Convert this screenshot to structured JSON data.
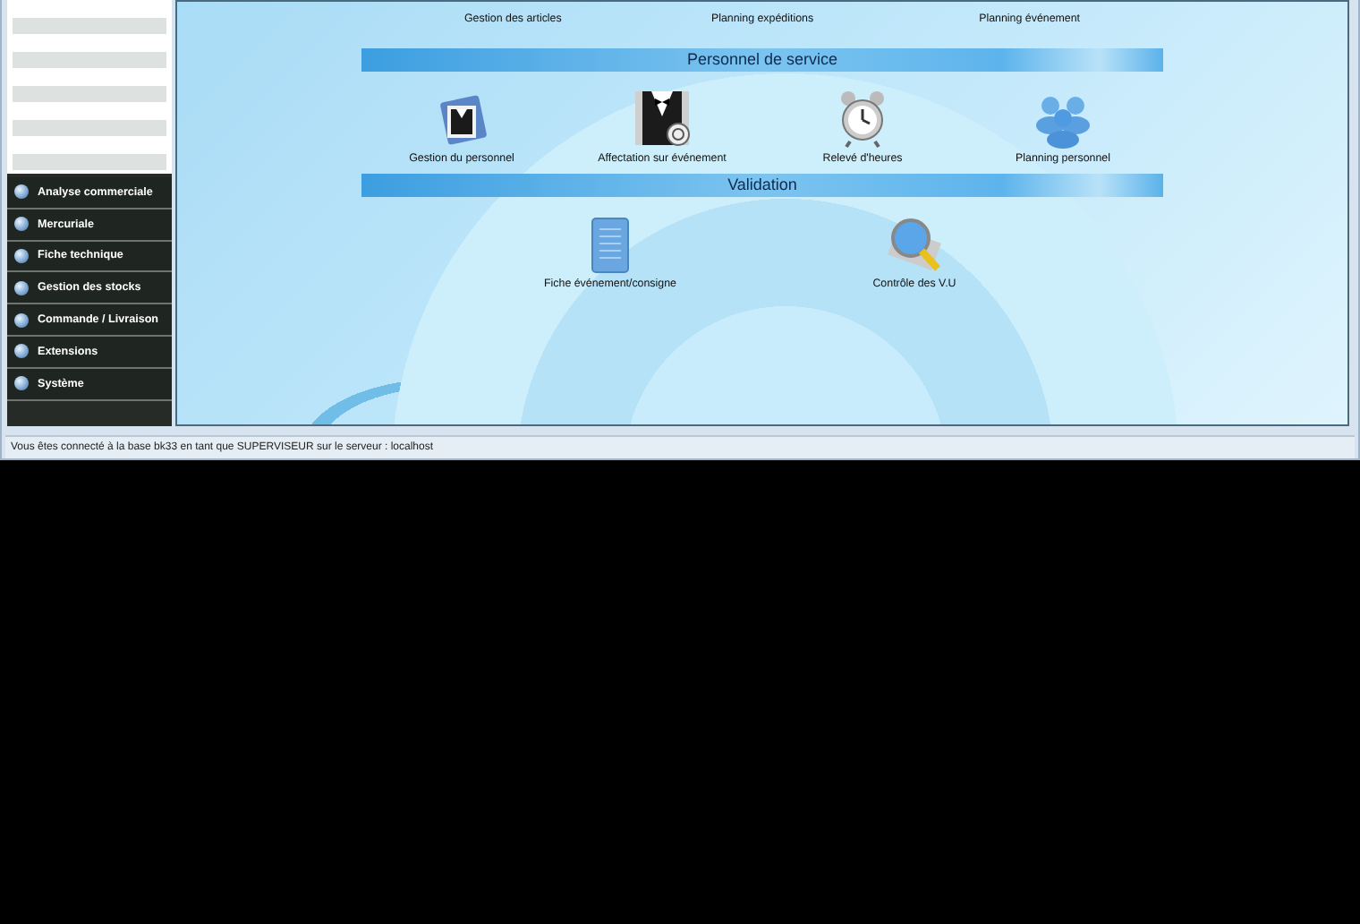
{
  "sidebar": {
    "menu": [
      {
        "label": "Analyse commerciale"
      },
      {
        "label": "Mercuriale"
      },
      {
        "label": "Fiche technique"
      },
      {
        "label": "Gestion des stocks"
      },
      {
        "label": "Commande / Livraison"
      },
      {
        "label": "Extensions"
      },
      {
        "label": "Système"
      }
    ]
  },
  "top_row": [
    {
      "label": "Gestion des articles"
    },
    {
      "label": "Planning expéditions"
    },
    {
      "label": "Planning événement"
    }
  ],
  "sections": [
    {
      "title": "Personnel de service",
      "items": [
        {
          "label": "Gestion du personnel",
          "kind": "staff"
        },
        {
          "label": "Affectation sur événement",
          "kind": "tuxedo"
        },
        {
          "label": "Relevé d'heures",
          "kind": "clock"
        },
        {
          "label": "Planning personnel",
          "kind": "people"
        }
      ]
    },
    {
      "title": "Validation",
      "items": [
        {
          "label": "Fiche événement/consigne",
          "kind": "document"
        },
        {
          "label": "Contrôle des V.U",
          "kind": "magnifier"
        }
      ]
    }
  ],
  "status_bar": "Vous êtes connecté à la base bk33 en tant que SUPERVISEUR sur le serveur : localhost"
}
